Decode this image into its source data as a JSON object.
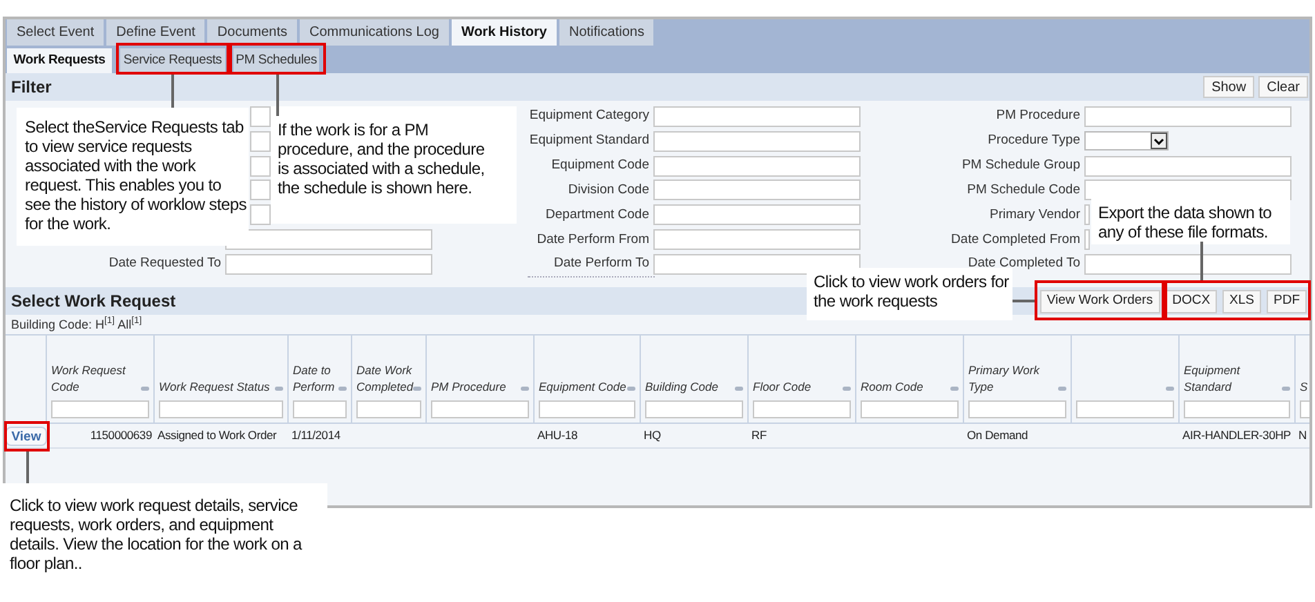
{
  "main_tabs": [
    {
      "label": "Select Event",
      "selected": false
    },
    {
      "label": "Define Event",
      "selected": false
    },
    {
      "label": "Documents",
      "selected": false
    },
    {
      "label": "Communications Log",
      "selected": false
    },
    {
      "label": "Work History",
      "selected": true
    },
    {
      "label": "Notifications",
      "selected": false
    }
  ],
  "sub_tabs": [
    {
      "label": "Work Requests",
      "selected": true
    },
    {
      "label": "Service Requests",
      "selected": false
    },
    {
      "label": "PM Schedules",
      "selected": false
    }
  ],
  "filter": {
    "title": "Filter",
    "buttons": [
      "Show",
      "Clear"
    ],
    "columns": [
      [
        {
          "kind": "text"
        },
        {
          "kind": "text"
        },
        {
          "kind": "text"
        },
        {
          "kind": "text"
        },
        {
          "kind": "text"
        },
        {
          "kind": "text"
        },
        {
          "label": "Date Requested To",
          "kind": "text"
        }
      ],
      [
        {
          "label": "Equipment Category",
          "kind": "text"
        },
        {
          "label": "Equipment Standard",
          "kind": "text"
        },
        {
          "label": "Equipment Code",
          "kind": "text"
        },
        {
          "label": "Division Code",
          "kind": "text"
        },
        {
          "label": "Department Code",
          "kind": "text"
        },
        {
          "label": "Date Perform From",
          "kind": "text"
        },
        {
          "label": "Date Perform To",
          "kind": "text"
        }
      ],
      [
        {
          "label": "PM Procedure",
          "kind": "text"
        },
        {
          "label": "Procedure Type",
          "kind": "select"
        },
        {
          "label": "PM Schedule Group",
          "kind": "text"
        },
        {
          "label": "PM Schedule Code",
          "kind": "text"
        },
        {
          "label": "Primary Vendor",
          "kind": "text"
        },
        {
          "label": "Date Completed From",
          "kind": "text"
        },
        {
          "label": "Date Completed To",
          "kind": "text"
        }
      ]
    ]
  },
  "grid": {
    "title": "Select Work Request",
    "building_filter": "Building Code: H$^{[1]}$ All$^{[1]}$",
    "actions": [
      "View Work Orders",
      "DOCX",
      "XLS",
      "PDF"
    ],
    "columns": [
      "",
      "Work Request Code",
      "Work Request Status",
      "Date to Perform",
      "Date Work Completed",
      "PM Procedure",
      "Equipment Code",
      "Building Code",
      "Floor Code",
      "Room Code",
      "Primary Work Type",
      "",
      "Equipment Standard",
      "S"
    ],
    "rows": [
      {
        "cells": [
          "View",
          "1150000639",
          "Assigned to Work Order",
          "1/11/2014",
          "",
          "",
          "AHU-18",
          "HQ",
          "RF",
          "",
          "On Demand",
          "",
          "AIR-HANDLER-30HP",
          "N"
        ]
      }
    ]
  },
  "callouts": [
    {
      "text": "Select theService Requests tab to view service requests associated with the work request. This enables you to see the history of worklow steps for the work."
    },
    {
      "text": "If the work is for a PM procedure, and the procedure is associated with a schedule, the schedule is shown here."
    },
    {
      "text": "Export the data shown to any of these file formats."
    },
    {
      "text": "Click to view work orders for the work requests"
    },
    {
      "text": "Click to view work request details, service requests, work orders, and equipment details. View the location for the work on a floor plan.."
    }
  ]
}
